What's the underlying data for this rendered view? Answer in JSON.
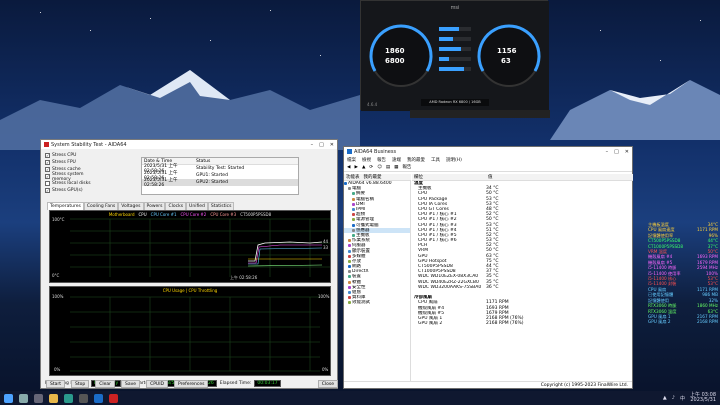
{
  "stability_window": {
    "title": "System Stability Test - AIDA64",
    "stress_items": [
      {
        "label": "Stress CPU",
        "checked": true
      },
      {
        "label": "Stress FPU",
        "checked": true
      },
      {
        "label": "Stress cache",
        "checked": true
      },
      {
        "label": "Stress system memory",
        "checked": true
      },
      {
        "label": "Stress local disks",
        "checked": false
      },
      {
        "label": "Stress GPU(s)",
        "checked": true
      }
    ],
    "status_headers": [
      "Date & Time",
      "Status"
    ],
    "status_rows": [
      [
        "2023/5/31 上午 02:58:26",
        "Stability Test: Started"
      ],
      [
        "2023/5/31 上午 02:58:26",
        "GPU1: Started"
      ],
      [
        "2023/5/31 上午 02:58:26",
        "GPU2: Started"
      ]
    ],
    "tabs": [
      "Temperatures",
      "Cooling Fans",
      "Voltages",
      "Powers",
      "Clocks",
      "Unified",
      "Statistics"
    ],
    "temp_legend": [
      "Motherboard",
      "CPU",
      "CPU Core #1",
      "CPU Core #2",
      "CPU Core #3",
      "CT500P5PSSD8"
    ],
    "temp_axis_top": "100°C",
    "temp_axis_bottom": "0°C",
    "temp_time": "上午 02:58:26",
    "temp_right_labels": [
      "44",
      "33"
    ],
    "usage_legend": "CPU Usage | CPU Throttling",
    "usage_axis_top": "100%",
    "usage_axis_bottom": "0%",
    "usage_right_top": "100%",
    "usage_right_bottom": "0%",
    "remaining_battery_label": "Remaining Battery:",
    "remaining_battery_value": "No battery",
    "test_started_label": "Test Started:",
    "test_started_value": "2023/5/31 上午 02:58:26",
    "elapsed_label": "Elapsed Time:",
    "elapsed_value": "00:03:17",
    "buttons": [
      "Start",
      "Stop",
      "Clear",
      "Save",
      "CPUID",
      "Preferences",
      "Close"
    ]
  },
  "aida_window": {
    "title": "AIDA64 Business",
    "menu": [
      "檔案",
      "檢視",
      "報告",
      "遠端",
      "我的最愛",
      "工具",
      "說明(H)"
    ],
    "toolbar_label": "報告",
    "pane_header_left": "功能表",
    "pane_header_mid": "我的最愛",
    "col_field": "欄位",
    "col_value": "值",
    "tree": [
      "AIDA64 v6.88.6400",
      "電腦",
      "摘要",
      "電腦名稱",
      "DMI",
      "IPMI",
      "超頻",
      "電源管理",
      "可攜式電腦",
      "感應器",
      "主機板",
      "作業系統",
      "伺服器",
      "顯示裝置",
      "多媒體",
      "存放",
      "網路",
      "DirectX",
      "裝置",
      "軟體",
      "安全性",
      "組態",
      "資料庫",
      "效能測試"
    ],
    "list": [
      {
        "f": "溫度",
        "v": "",
        "group": true
      },
      {
        "f": "主機板",
        "v": "34 °C"
      },
      {
        "f": "CPU",
        "v": "50 °C"
      },
      {
        "f": "CPU Package",
        "v": "53 °C"
      },
      {
        "f": "CPU IA Cores",
        "v": "53 °C"
      },
      {
        "f": "CPU GT Cores",
        "v": "48 °C"
      },
      {
        "f": "CPU #1 / 核心 #1",
        "v": "52 °C"
      },
      {
        "f": "CPU #1 / 核心 #2",
        "v": "50 °C"
      },
      {
        "f": "CPU #1 / 核心 #3",
        "v": "53 °C"
      },
      {
        "f": "CPU #1 / 核心 #4",
        "v": "51 °C"
      },
      {
        "f": "CPU #1 / 核心 #5",
        "v": "52 °C"
      },
      {
        "f": "CPU #1 / 核心 #6",
        "v": "53 °C"
      },
      {
        "f": "PCH",
        "v": "52 °C"
      },
      {
        "f": "VRM",
        "v": "50 °C"
      },
      {
        "f": "GPU",
        "v": "63 °C"
      },
      {
        "f": "GPU Hotspot",
        "v": "75 °C"
      },
      {
        "f": "CT500P5PSSD8",
        "v": "44 °C"
      },
      {
        "f": "CT1000P5PSSD8",
        "v": "37 °C"
      },
      {
        "f": "WDC WD10EZEX-08X3CA0",
        "v": "35 °C"
      },
      {
        "f": "WDC WD40EZRZ-22GXCB0",
        "v": "35 °C"
      },
      {
        "f": "WDC WD3200AAKS-75SBA0",
        "v": "36 °C"
      },
      {
        "f": "",
        "v": ""
      },
      {
        "f": "冷卻風扇",
        "v": "",
        "group": true
      },
      {
        "f": "CPU 風扇",
        "v": "1171 RPM"
      },
      {
        "f": "機殼風扇 #4",
        "v": "1693 RPM"
      },
      {
        "f": "機殼風扇 #5",
        "v": "1679 RPM"
      },
      {
        "f": "GPU 風扇 1",
        "v": "2168 RPM  (76%)"
      },
      {
        "f": "GPU 風扇 2",
        "v": "2168 RPM  (76%)"
      }
    ],
    "status_right": "Copyright (c) 1995-2023 FinalWire Ltd."
  },
  "msi": {
    "gpu_clock": "1860",
    "mem_clock": "6800",
    "voltage": "1156",
    "temp": "63",
    "card_name": "AMD Radeon RX 6800 / 16GB",
    "version": "4.6.4"
  },
  "osd": [
    [
      "主機板溫度",
      "34°C"
    ],
    [
      "CPU 風扇速度",
      "1171 RPM"
    ],
    [
      "記憶體使用率",
      "96%"
    ],
    [
      "CT500P5PSSD8",
      "44°C"
    ],
    [
      "CT1000P5PSSD8",
      "37°C"
    ],
    [
      "VRM 溫度",
      "50°C"
    ],
    [
      "機殼風扇 #4",
      "1693 RPM"
    ],
    [
      "機殼風扇 #5",
      "1679 RPM"
    ],
    [
      "i5-11400 時脈",
      "2594 MHz"
    ],
    [
      "i5-11400 使用率",
      "100%"
    ],
    [
      "i5-11400 核心",
      "53°C"
    ],
    [
      "i5-11400 封裝",
      "53°C"
    ],
    [
      "CPU 風扇",
      "1171 RPM"
    ],
    [
      "已使用記憶體",
      "986 MB"
    ],
    [
      "記憶體使用",
      "32%"
    ],
    [
      "RTX3060 時脈",
      "1860 MHz"
    ],
    [
      "RTX3060 溫度",
      "63°C"
    ],
    [
      "GPU 風扇 1",
      "2167 RPM"
    ],
    [
      "GPU 風扇 2",
      "2168 RPM"
    ]
  ],
  "taskbar": {
    "ime": "中",
    "time": "上午 03:08",
    "date": "2023/5/31"
  },
  "colors": {
    "green": "#22cc22",
    "aida_blue": "#1a6cc8"
  }
}
